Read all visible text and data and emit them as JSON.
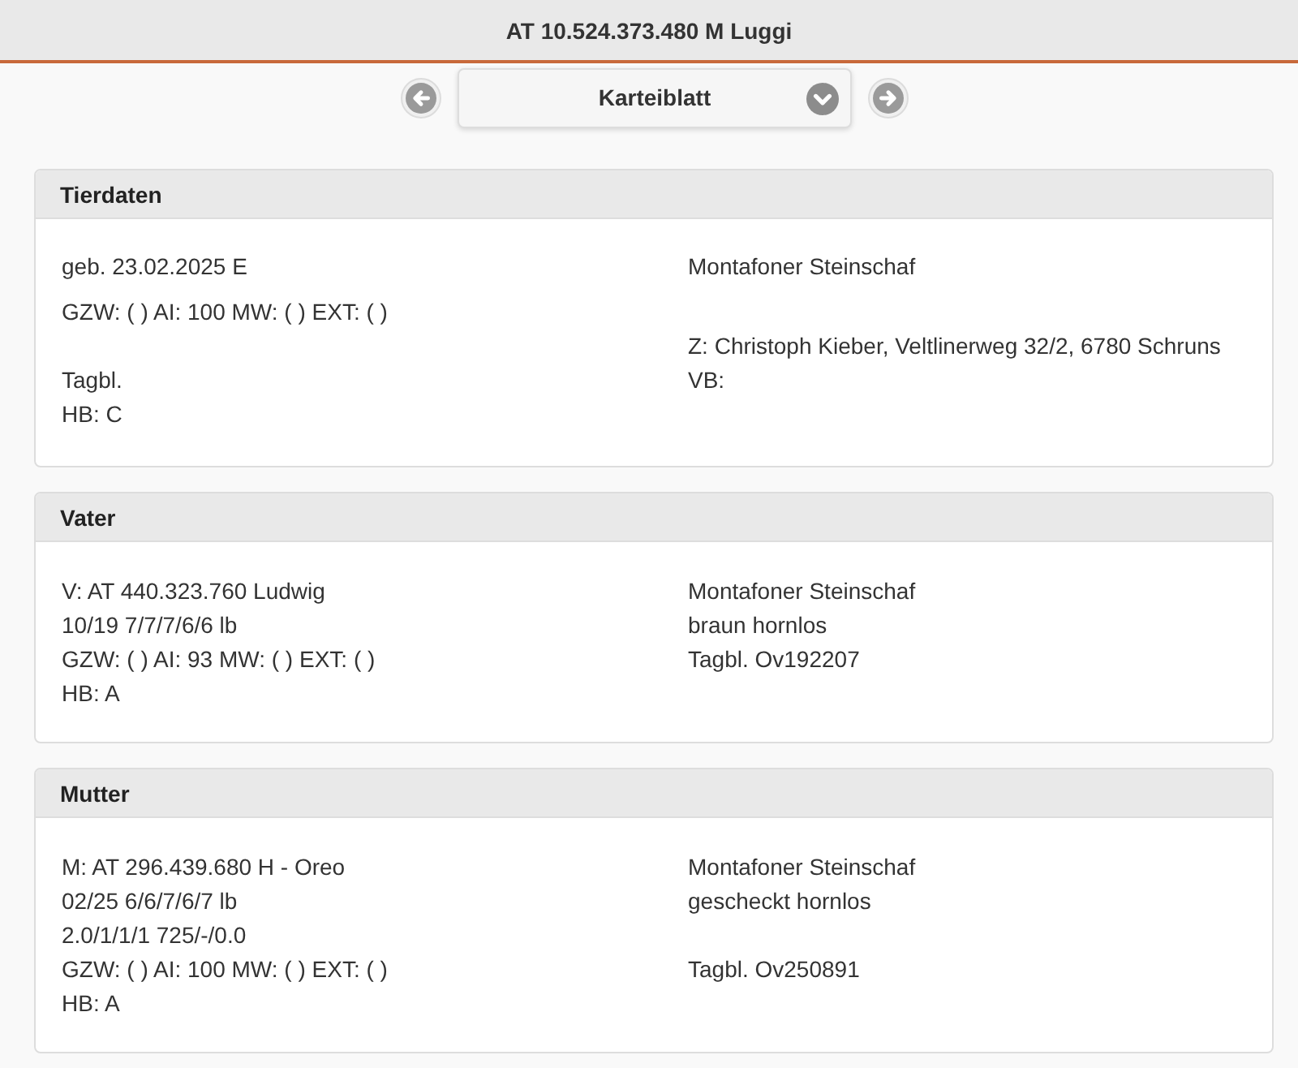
{
  "header": {
    "title": "AT 10.524.373.480 M Luggi"
  },
  "nav": {
    "page_select": {
      "value": "Karteiblatt"
    }
  },
  "cards": [
    {
      "title": "Tierdaten",
      "kind": "summary",
      "rows": [
        {
          "left": "geb. 23.02.2025 E",
          "right": "Montafoner Steinschaf"
        },
        {
          "left": "GZW: ( ) AI: 100 MW: ( ) EXT: ( )"
        },
        {
          "right": "Z: Christoph Kieber, Veltlinerweg 32/2, 6780 Schruns"
        },
        {
          "left": "Tagbl.",
          "right": "VB:"
        },
        {
          "left": "HB: C"
        }
      ]
    },
    {
      "title": "Vater",
      "kind": "parent",
      "rows": [
        {
          "left": "V: AT 440.323.760 Ludwig",
          "right": "Montafoner Steinschaf"
        },
        {
          "left": "10/19 7/7/7/6/6 lb",
          "right": "braun hornlos"
        },
        {
          "left": "GZW: ( ) AI: 93 MW: ( ) EXT: ( )",
          "right": "Tagbl. Ov192207"
        },
        {
          "left": "HB: A"
        }
      ]
    },
    {
      "title": "Mutter",
      "kind": "parent",
      "rows": [
        {
          "left": "M: AT 296.439.680 H - Oreo",
          "right": "Montafoner Steinschaf"
        },
        {
          "left": "02/25 6/6/7/6/7 lb",
          "right": "gescheckt hornlos"
        },
        {
          "left": "2.0/1/1/1 725/-/0.0"
        },
        {
          "left": "GZW: ( ) AI: 100 MW: ( ) EXT: ( )",
          "right": "Tagbl. Ov250891"
        },
        {
          "left": "HB: A"
        }
      ]
    }
  ]
}
